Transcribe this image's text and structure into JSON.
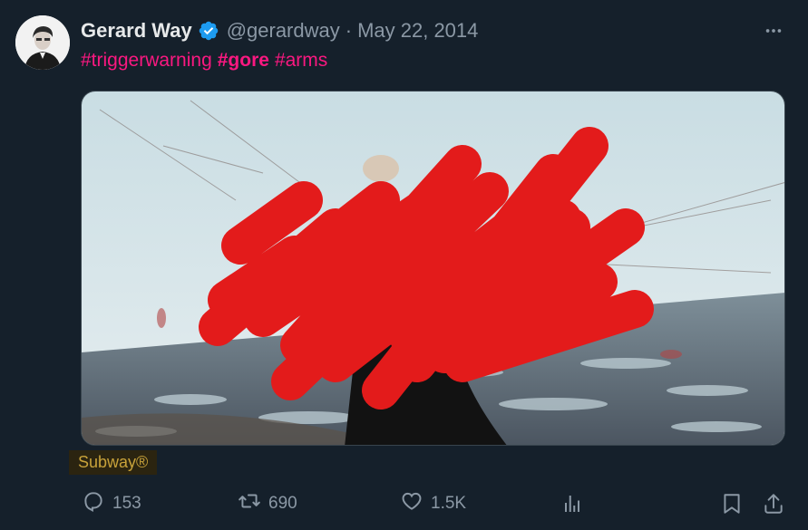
{
  "tweet": {
    "author_name": "Gerard Way",
    "handle": "@gerardway",
    "separator": "·",
    "date": "May 22, 2014",
    "hashtags": [
      {
        "text": "#triggerwarning",
        "bold": false
      },
      {
        "text": "#gore",
        "bold": true
      },
      {
        "text": "#arms",
        "bold": false
      }
    ],
    "media_tag": "Subway®",
    "actions": {
      "replies": "153",
      "retweets": "690",
      "likes": "1.5K"
    }
  },
  "colors": {
    "background": "#15202b",
    "hashtag": "#f91880",
    "muted": "#8b98a5",
    "verified": "#1d9bf0",
    "redaction": "#e31b1b"
  },
  "icons": [
    "verified-badge-icon",
    "more-icon",
    "reply-icon",
    "retweet-icon",
    "like-icon",
    "views-icon",
    "bookmark-icon",
    "share-icon"
  ]
}
